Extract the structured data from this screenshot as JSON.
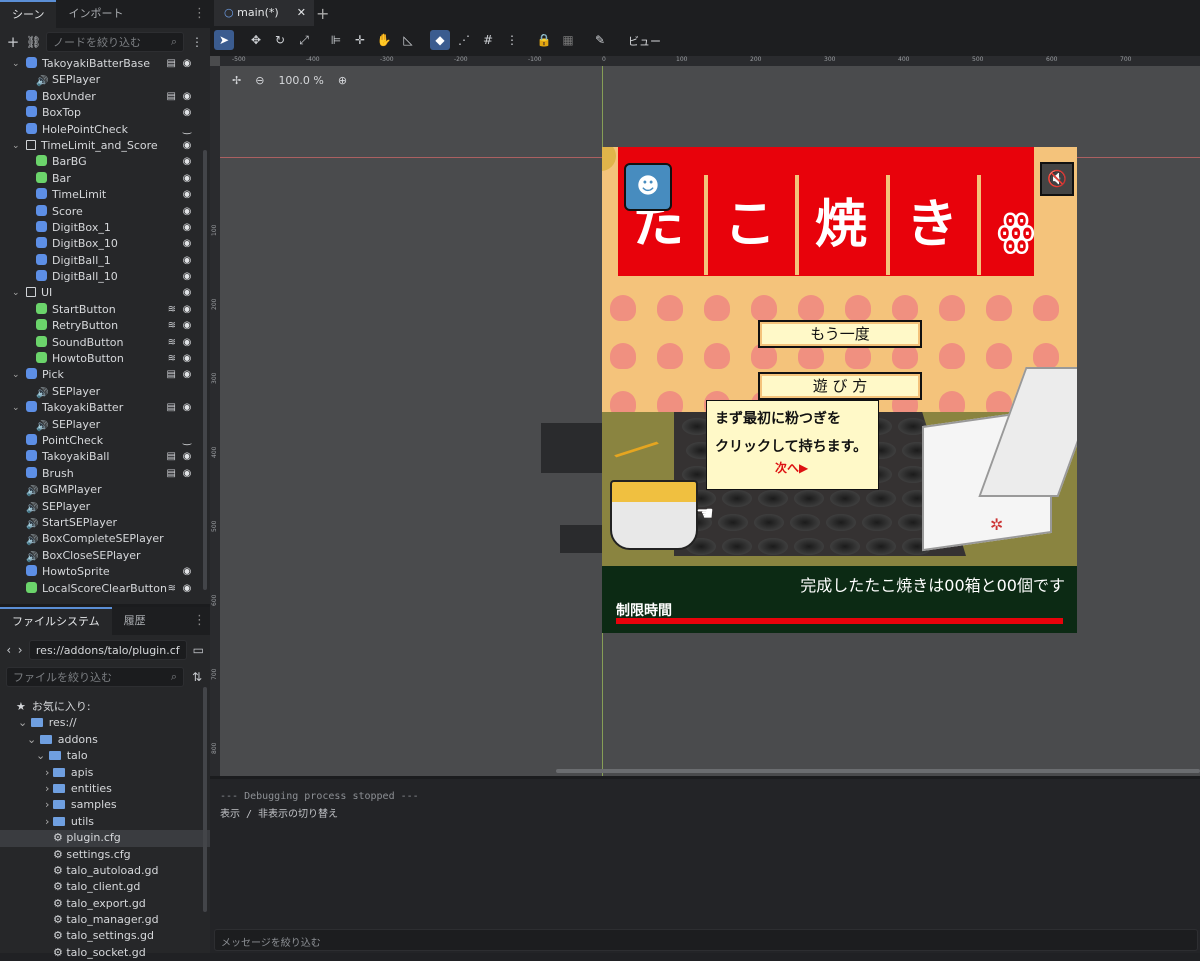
{
  "left_panel": {
    "tabs": [
      "シーン",
      "インポート"
    ],
    "filter_placeholder": "ノードを絞り込む",
    "nodes": [
      {
        "label": "TakoyakiBatterBase",
        "indent": 1,
        "kind": "blue",
        "expand": "v",
        "script": true,
        "eye": true
      },
      {
        "label": "SEPlayer",
        "indent": 2,
        "kind": "snd"
      },
      {
        "label": "BoxUnder",
        "indent": 1,
        "kind": "blue",
        "script": true,
        "eye": true
      },
      {
        "label": "BoxTop",
        "indent": 1,
        "kind": "blue",
        "eye": true
      },
      {
        "label": "HolePointCheck",
        "indent": 1,
        "kind": "blue",
        "hidden": true
      },
      {
        "label": "TimeLimit_and_Score",
        "indent": 1,
        "kind": "ctrl",
        "expand": "v",
        "eye": true
      },
      {
        "label": "BarBG",
        "indent": 2,
        "kind": "green",
        "eye": true
      },
      {
        "label": "Bar",
        "indent": 2,
        "kind": "green",
        "eye": true
      },
      {
        "label": "TimeLimit",
        "indent": 2,
        "kind": "blue",
        "eye": true
      },
      {
        "label": "Score",
        "indent": 2,
        "kind": "blue",
        "eye": true
      },
      {
        "label": "DigitBox_1",
        "indent": 2,
        "kind": "blue",
        "eye": true
      },
      {
        "label": "DigitBox_10",
        "indent": 2,
        "kind": "blue",
        "eye": true
      },
      {
        "label": "DigitBall_1",
        "indent": 2,
        "kind": "blue",
        "eye": true
      },
      {
        "label": "DigitBall_10",
        "indent": 2,
        "kind": "blue",
        "eye": true
      },
      {
        "label": "UI",
        "indent": 1,
        "kind": "ctrl",
        "expand": "v",
        "eye": true
      },
      {
        "label": "StartButton",
        "indent": 2,
        "kind": "green",
        "signal": true,
        "eye": true
      },
      {
        "label": "RetryButton",
        "indent": 2,
        "kind": "green",
        "signal": true,
        "eye": true
      },
      {
        "label": "SoundButton",
        "indent": 2,
        "kind": "green",
        "signal": true,
        "eye": true
      },
      {
        "label": "HowtoButton",
        "indent": 2,
        "kind": "green",
        "signal": true,
        "eye": true
      },
      {
        "label": "Pick",
        "indent": 1,
        "kind": "blue",
        "expand": "v",
        "script": true,
        "eye": true
      },
      {
        "label": "SEPlayer",
        "indent": 2,
        "kind": "snd"
      },
      {
        "label": "TakoyakiBatter",
        "indent": 1,
        "kind": "blue",
        "expand": "v",
        "script": true,
        "eye": true
      },
      {
        "label": "SEPlayer",
        "indent": 2,
        "kind": "snd"
      },
      {
        "label": "PointCheck",
        "indent": 1,
        "kind": "blue",
        "hidden": true
      },
      {
        "label": "TakoyakiBall",
        "indent": 1,
        "kind": "blue",
        "script": true,
        "eye": true
      },
      {
        "label": "Brush",
        "indent": 1,
        "kind": "blue",
        "script": true,
        "eye": true
      },
      {
        "label": "BGMPlayer",
        "indent": 1,
        "kind": "snd"
      },
      {
        "label": "SEPlayer",
        "indent": 1,
        "kind": "snd"
      },
      {
        "label": "StartSEPlayer",
        "indent": 1,
        "kind": "snd"
      },
      {
        "label": "BoxCompleteSEPlayer",
        "indent": 1,
        "kind": "snd"
      },
      {
        "label": "BoxCloseSEPlayer",
        "indent": 1,
        "kind": "snd"
      },
      {
        "label": "HowtoSprite",
        "indent": 1,
        "kind": "blue",
        "eye": true
      },
      {
        "label": "LocalScoreClearButton",
        "indent": 1,
        "kind": "green",
        "signal": true,
        "eye": true
      }
    ]
  },
  "filesystem": {
    "tabs": [
      "ファイルシステム",
      "履歴"
    ],
    "path": "res://addons/talo/plugin.cf",
    "filter_placeholder": "ファイルを絞り込む",
    "favorites_label": "お気に入り:",
    "items": [
      {
        "label": "res://",
        "indent": 0,
        "type": "folder",
        "expand": "v"
      },
      {
        "label": "addons",
        "indent": 1,
        "type": "folder",
        "expand": "v"
      },
      {
        "label": "talo",
        "indent": 2,
        "type": "folder",
        "expand": "v"
      },
      {
        "label": "apis",
        "indent": 3,
        "type": "folder",
        "expand": ">"
      },
      {
        "label": "entities",
        "indent": 3,
        "type": "folder",
        "expand": ">"
      },
      {
        "label": "samples",
        "indent": 3,
        "type": "folder",
        "expand": ">"
      },
      {
        "label": "utils",
        "indent": 3,
        "type": "folder",
        "expand": ">"
      },
      {
        "label": "plugin.cfg",
        "indent": 3,
        "type": "file",
        "selected": true
      },
      {
        "label": "settings.cfg",
        "indent": 3,
        "type": "file"
      },
      {
        "label": "talo_autoload.gd",
        "indent": 3,
        "type": "file"
      },
      {
        "label": "talo_client.gd",
        "indent": 3,
        "type": "file"
      },
      {
        "label": "talo_export.gd",
        "indent": 3,
        "type": "file"
      },
      {
        "label": "talo_manager.gd",
        "indent": 3,
        "type": "file"
      },
      {
        "label": "talo_settings.gd",
        "indent": 3,
        "type": "file"
      },
      {
        "label": "talo_socket.gd",
        "indent": 3,
        "type": "file"
      }
    ]
  },
  "editor": {
    "tab_label": "main(*)",
    "view_menu": "ビュー",
    "zoom": "100.0 %",
    "ruler_top": [
      "-500",
      "-400",
      "-300",
      "-200",
      "-100",
      "0",
      "100",
      "200",
      "300",
      "400",
      "500",
      "600",
      "700"
    ],
    "ruler_left": [
      "100",
      "200",
      "300",
      "400",
      "500",
      "600",
      "700",
      "800"
    ]
  },
  "game": {
    "title_chars": [
      "た",
      "こ",
      "焼",
      "き"
    ],
    "retry_label": "もう一度",
    "howto_label": "遊 び 方",
    "bubble_line1": "まず最初に粉つぎを",
    "bubble_line2": "クリックして持ちます。",
    "bubble_next": "次へ▶",
    "score_text": "完成したたこ焼きは00箱と00個です",
    "time_label": "制限時間"
  },
  "console": {
    "line1": "--- Debugging process stopped ---",
    "line2": "表示 / 非表示の切り替え",
    "filter_placeholder": "メッセージを絞り込む"
  }
}
